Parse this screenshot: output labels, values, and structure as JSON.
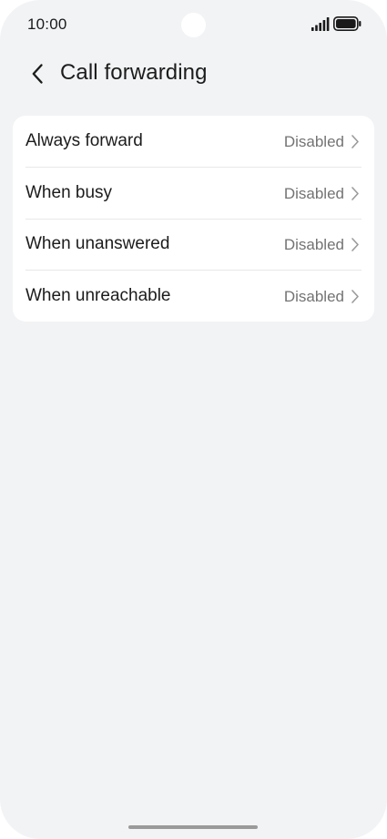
{
  "status_bar": {
    "time": "10:00"
  },
  "header": {
    "title": "Call forwarding"
  },
  "settings": {
    "items": [
      {
        "label": "Always forward",
        "value": "Disabled"
      },
      {
        "label": "When busy",
        "value": "Disabled"
      },
      {
        "label": "When unanswered",
        "value": "Disabled"
      },
      {
        "label": "When unreachable",
        "value": "Disabled"
      }
    ]
  }
}
